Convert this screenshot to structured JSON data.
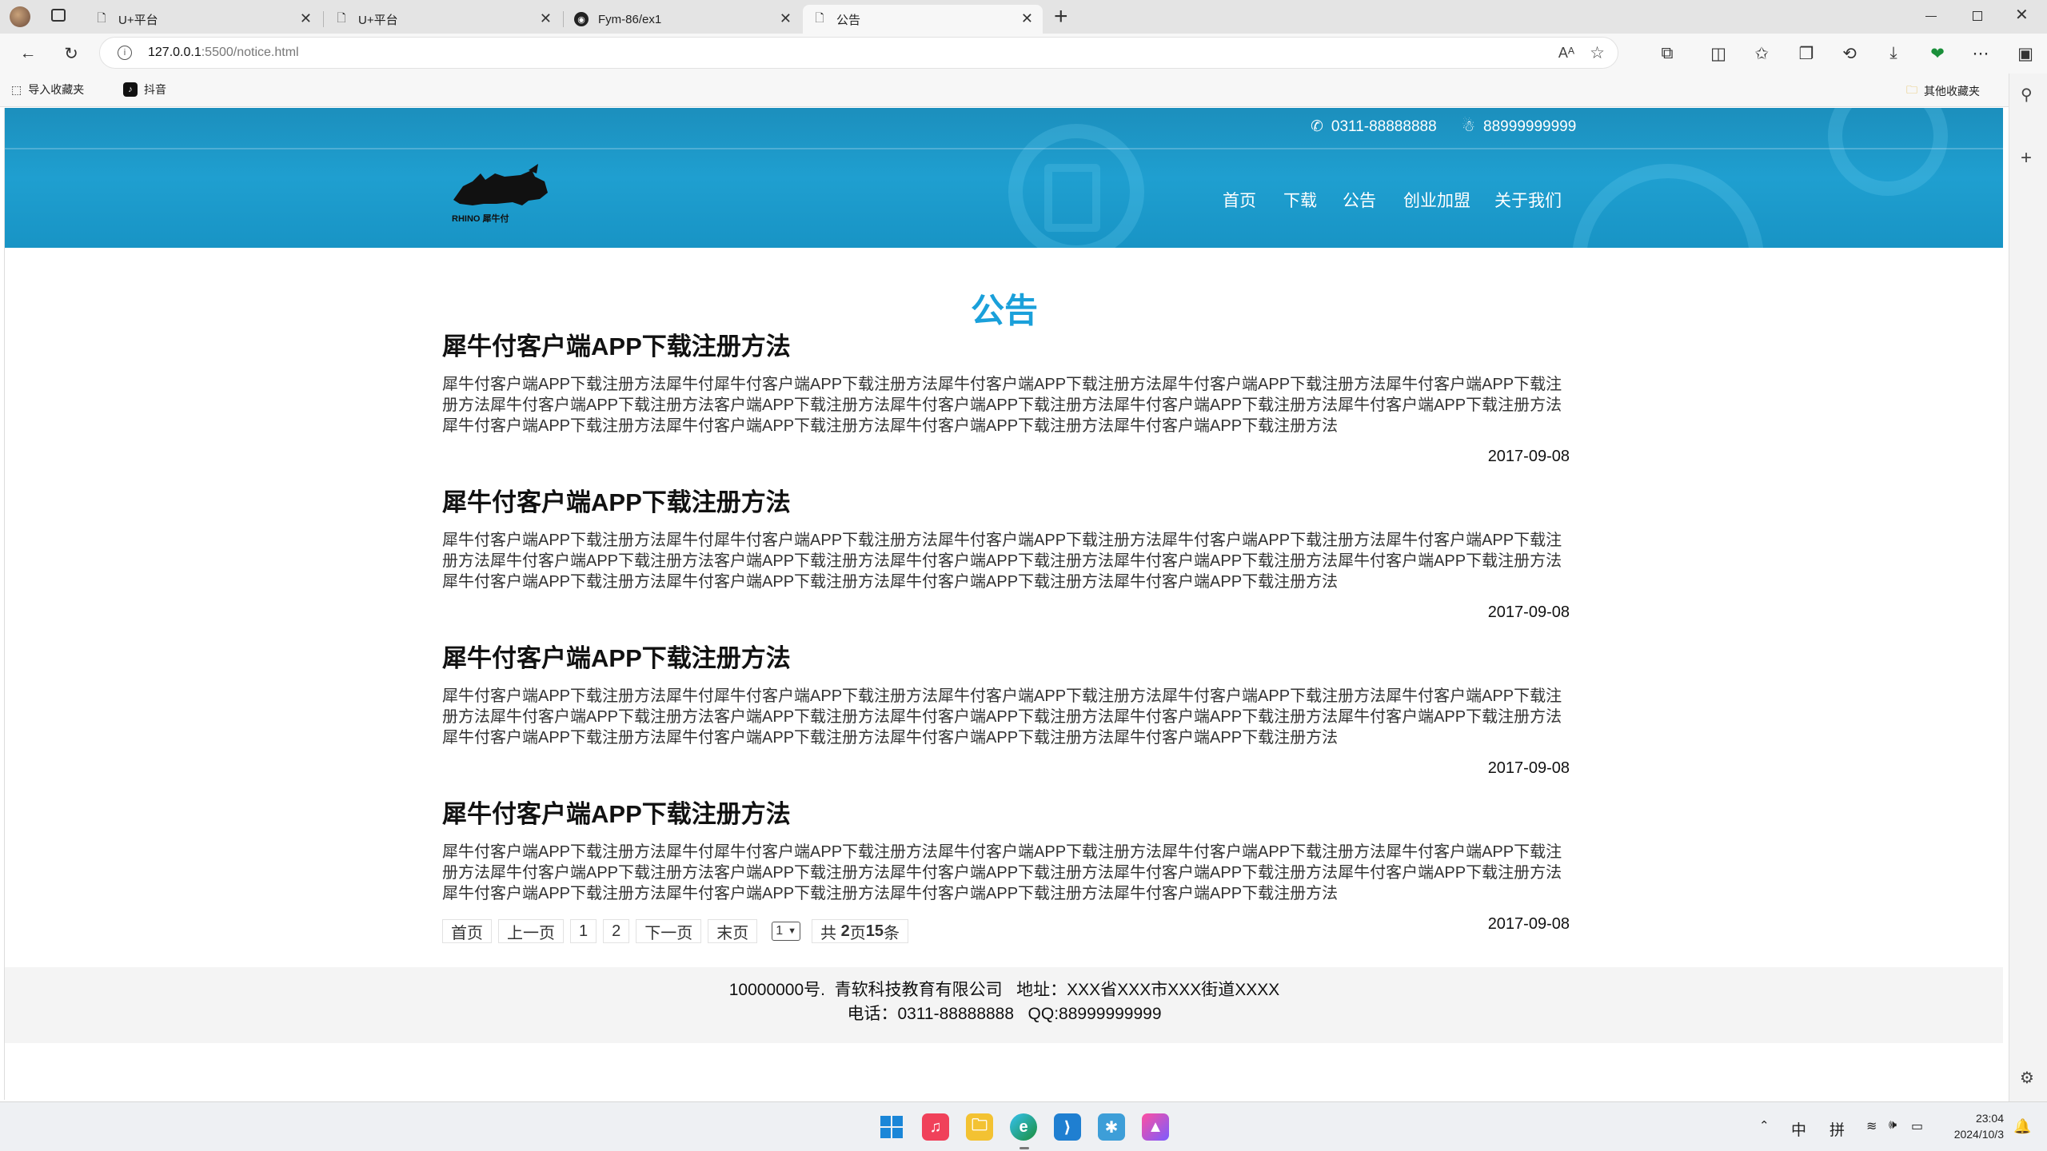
{
  "browser": {
    "tabs": [
      {
        "title": "U+平台",
        "icon": "page-icon"
      },
      {
        "title": "U+平台",
        "icon": "page-icon"
      },
      {
        "title": "Fym-86/ex1",
        "icon": "github-icon"
      },
      {
        "title": "公告",
        "icon": "page-icon"
      }
    ],
    "new_tab": "+",
    "url_host": "127.0.0.1",
    "url_path": ":5500/notice.html",
    "bookmarks": [
      {
        "label": "导入收藏夹",
        "icon": "import-icon"
      },
      {
        "label": "抖音",
        "icon": "tiktok-icon"
      }
    ],
    "other_favorites": "其他收藏夹"
  },
  "site": {
    "phone": "0311-88888888",
    "qq": "88999999999",
    "logo_text": "RHINO 犀牛付",
    "nav": [
      "首页",
      "下载",
      "公告",
      "创业加盟",
      "关于我们"
    ],
    "accent": "#1aa0da",
    "header_color": "#1f9fd0"
  },
  "page": {
    "title": "公告",
    "notices": [
      {
        "title": "犀牛付客户端APP下载注册方法",
        "body": "犀牛付客户端APP下载注册方法犀牛付犀牛付客户端APP下载注册方法犀牛付客户端APP下载注册方法犀牛付客户端APP下载注册方法犀牛付客户端APP下载注册方法犀牛付客户端APP下载注册方法客户端APP下载注册方法犀牛付客户端APP下载注册方法犀牛付客户端APP下载注册方法犀牛付客户端APP下载注册方法犀牛付客户端APP下载注册方法犀牛付客户端APP下载注册方法犀牛付客户端APP下载注册方法犀牛付客户端APP下载注册方法",
        "date": "2017-09-08"
      },
      {
        "title": "犀牛付客户端APP下载注册方法",
        "body": "犀牛付客户端APP下载注册方法犀牛付犀牛付客户端APP下载注册方法犀牛付客户端APP下载注册方法犀牛付客户端APP下载注册方法犀牛付客户端APP下载注册方法犀牛付客户端APP下载注册方法客户端APP下载注册方法犀牛付客户端APP下载注册方法犀牛付客户端APP下载注册方法犀牛付客户端APP下载注册方法犀牛付客户端APP下载注册方法犀牛付客户端APP下载注册方法犀牛付客户端APP下载注册方法犀牛付客户端APP下载注册方法",
        "date": "2017-09-08"
      },
      {
        "title": "犀牛付客户端APP下载注册方法",
        "body": "犀牛付客户端APP下载注册方法犀牛付犀牛付客户端APP下载注册方法犀牛付客户端APP下载注册方法犀牛付客户端APP下载注册方法犀牛付客户端APP下载注册方法犀牛付客户端APP下载注册方法客户端APP下载注册方法犀牛付客户端APP下载注册方法犀牛付客户端APP下载注册方法犀牛付客户端APP下载注册方法犀牛付客户端APP下载注册方法犀牛付客户端APP下载注册方法犀牛付客户端APP下载注册方法犀牛付客户端APP下载注册方法",
        "date": "2017-09-08"
      },
      {
        "title": "犀牛付客户端APP下载注册方法",
        "body": "犀牛付客户端APP下载注册方法犀牛付犀牛付客户端APP下载注册方法犀牛付客户端APP下载注册方法犀牛付客户端APP下载注册方法犀牛付客户端APP下载注册方法犀牛付客户端APP下载注册方法客户端APP下载注册方法犀牛付客户端APP下载注册方法犀牛付客户端APP下载注册方法犀牛付客户端APP下载注册方法犀牛付客户端APP下载注册方法犀牛付客户端APP下载注册方法犀牛付客户端APP下载注册方法犀牛付客户端APP下载注册方法",
        "date": "2017-09-08"
      }
    ],
    "pager": {
      "first": "首页",
      "prev": "上一页",
      "pages": [
        "1",
        "2"
      ],
      "next": "下一页",
      "last": "末页",
      "select_value": "1",
      "total_prefix": "共",
      "total_pages": "2",
      "pages_unit": "页",
      "total_items": "15",
      "items_unit": "条"
    }
  },
  "footer": {
    "line1": "10000000号.  青软科技教育有限公司   地址：XXX省XXX市XXX街道XXXX",
    "line2": "电话：0311-88888888   QQ:88999999999"
  },
  "taskbar": {
    "ime1": "中",
    "ime2": "拼",
    "time": "23:04",
    "date": "2024/10/3"
  }
}
